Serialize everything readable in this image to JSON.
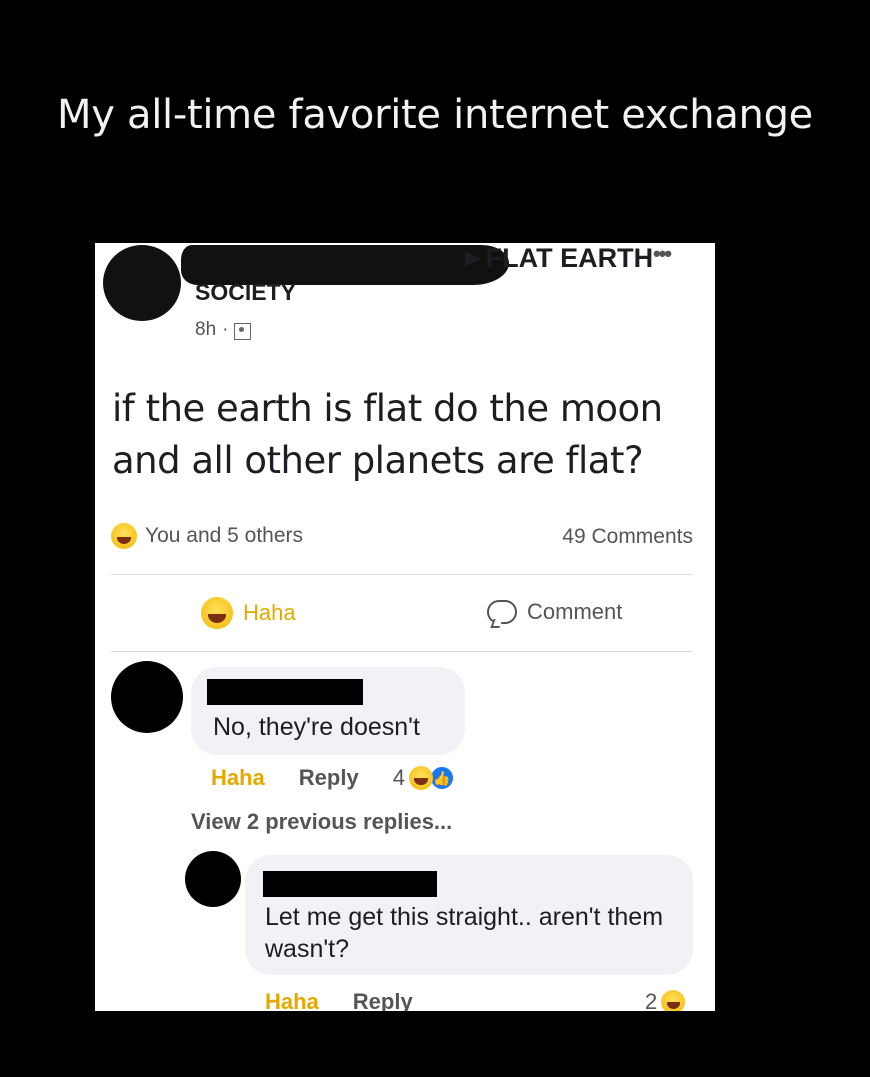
{
  "caption": "My all-time favorite internet exchange",
  "post": {
    "group": "FLAT EARTH",
    "group_suffix": "SOCIETY",
    "time": "8h",
    "text": "if the earth is flat do the moon and all other planets are flat?",
    "reactions_text": "You and 5 others",
    "comments_count": "49 Comments",
    "haha_label": "Haha",
    "comment_label": "Comment"
  },
  "comments": [
    {
      "text": "No, they're doesn't",
      "haha": "Haha",
      "reply": "Reply",
      "reaction_count": "4"
    },
    {
      "text": "Let me get this straight.. aren't them wasn't?",
      "haha": "Haha",
      "reply": "Reply",
      "reaction_count": "2"
    }
  ],
  "view_replies": "View 2 previous replies...",
  "colors": {
    "haha": "#e3a900",
    "like": "#1877f2",
    "bubble": "#f0f2f5"
  }
}
